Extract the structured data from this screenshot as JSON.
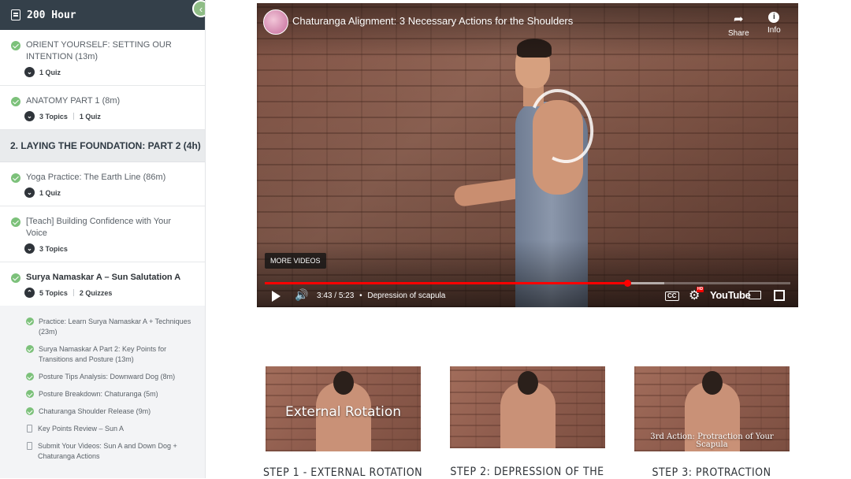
{
  "sidebar": {
    "course_title": "200 Hour",
    "lessons_top": [
      {
        "title": "ORIENT YOURSELF: SETTING OUR INTENTION (13m)",
        "meta": [
          "1 Quiz"
        ]
      },
      {
        "title": "ANATOMY PART 1 (8m)",
        "meta": [
          "3 Topics",
          "1 Quiz"
        ]
      }
    ],
    "section": {
      "title": "2. LAYING THE FOUNDATION: PART 2 (4h)"
    },
    "lessons": [
      {
        "title": "Yoga Practice: The Earth Line (86m)",
        "meta": [
          "1 Quiz"
        ]
      },
      {
        "title": "[Teach] Building Confidence with Your Voice",
        "meta": [
          "3 Topics"
        ]
      },
      {
        "title": "Surya Namaskar A – Sun Salutation A",
        "meta": [
          "5 Topics",
          "2 Quizzes"
        ]
      }
    ],
    "topics": [
      {
        "title": "Practice: Learn Surya Namaskar A + Techniques (23m)",
        "status": "complete"
      },
      {
        "title": "Surya Namaskar A Part 2: Key Points for Transitions and Posture (13m)",
        "status": "complete"
      },
      {
        "title": "Posture Tips Analysis: Downward Dog (8m)",
        "status": "complete"
      },
      {
        "title": "Posture Breakdown: Chaturanga (5m)",
        "status": "complete"
      },
      {
        "title": "Chaturanga Shoulder Release (9m)",
        "status": "complete"
      },
      {
        "title": "Key Points Review – Sun A",
        "status": "quiz"
      },
      {
        "title": "Submit Your Videos: Sun A and Down Dog + Chaturanga Actions",
        "status": "quiz"
      }
    ]
  },
  "video": {
    "title": "Chaturanga Alignment: 3 Necessary Actions for the Shoulders",
    "share_label": "Share",
    "info_label": "Info",
    "more_videos_label": "MORE VIDEOS",
    "current_time": "3:43",
    "duration": "5:23",
    "time_separator": " / ",
    "chapter": "Depression of scapula",
    "played_fraction": 0.69,
    "buffered_fraction": 0.76,
    "cc_label": "CC",
    "hd_badge": "HD",
    "brand": "YouTube",
    "icons": [
      "play-icon",
      "volume-icon",
      "captions-icon",
      "settings-icon",
      "airplay-icon",
      "fullscreen-icon",
      "share-icon",
      "info-icon"
    ]
  },
  "steps": [
    {
      "thumb_caption": "External Rotation",
      "heading": "STEP 1 - EXTERNAL ROTATION"
    },
    {
      "thumb_caption": "",
      "heading": "STEP 2: DEPRESSION OF THE"
    },
    {
      "thumb_caption": "3rd Action: Protraction of Your Scapula",
      "heading": "STEP 3: PROTRACTION"
    }
  ],
  "colors": {
    "sidebar_header": "#34404a",
    "check_green": "#7cc17a",
    "progress_red": "#ff0000",
    "section_bg": "#e9ebed"
  }
}
